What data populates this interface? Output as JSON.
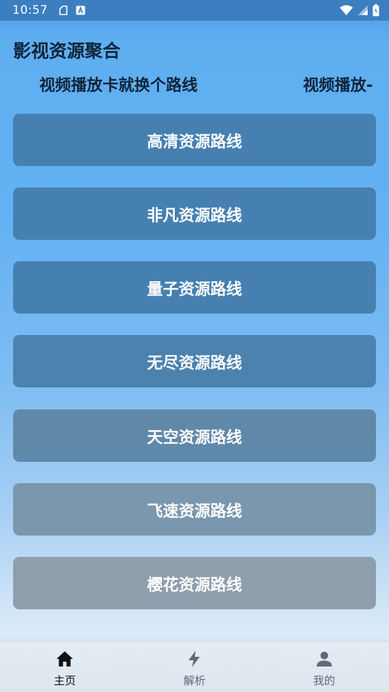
{
  "statusbar": {
    "time": "10:57",
    "icons": [
      "sim-card-icon",
      "accessibility-a-icon",
      "wifi-icon",
      "cellular-signal-icon",
      "battery-icon"
    ]
  },
  "header": {
    "title": "影视资源聚合"
  },
  "marquee": {
    "text_main": "视频播放卡就换个路线",
    "text_trailing": "视频播放-"
  },
  "routes": [
    {
      "label": "高清资源路线",
      "color": "#4680b1"
    },
    {
      "label": "非凡资源路线",
      "color": "#4680b1"
    },
    {
      "label": "量子资源路线",
      "color": "#4680b1"
    },
    {
      "label": "无尽资源路线",
      "color": "#4c82ae"
    },
    {
      "label": "天空资源路线",
      "color": "#6088a9"
    },
    {
      "label": "飞速资源路线",
      "color": "#7b97ae"
    },
    {
      "label": "樱花资源路线",
      "color": "#8e9ead"
    }
  ],
  "bottom_nav": {
    "items": [
      {
        "label": "主页",
        "icon": "home-icon",
        "active": true
      },
      {
        "label": "解析",
        "icon": "lightning-bolt-icon",
        "active": false
      },
      {
        "label": "我的",
        "icon": "person-icon",
        "active": false
      }
    ]
  }
}
